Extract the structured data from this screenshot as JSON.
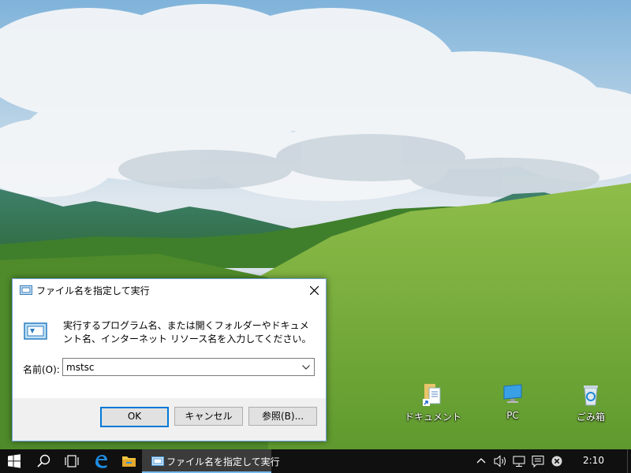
{
  "run_dialog": {
    "title": "ファイル名を指定して実行",
    "description": "実行するプログラム名、または開くフォルダーやドキュメント名、インターネット リソース名を入力してください。",
    "name_label": "名前(O):",
    "input_value": "mstsc",
    "ok_label": "OK",
    "cancel_label": "キャンセル",
    "browse_label": "参照(B)...",
    "icons": [
      "run-icon",
      "close-icon",
      "chevron-down-icon"
    ]
  },
  "desktop": {
    "icons": [
      {
        "label": "ドキュメント",
        "icon": "documents-shortcut-icon"
      },
      {
        "label": "PC",
        "icon": "pc-icon"
      },
      {
        "label": "ごみ箱",
        "icon": "recycle-bin-icon"
      }
    ]
  },
  "taskbar": {
    "pinned": [
      "start-icon",
      "search-icon",
      "task-view-icon",
      "edge-icon",
      "file-explorer-icon"
    ],
    "running_app_label": "ファイル名を指定して実行",
    "tray": [
      "chevron-up-icon",
      "volume-icon",
      "network-icon",
      "action-center-icon",
      "notification-off-icon"
    ],
    "clock": "2:10"
  },
  "colors": {
    "taskbar_bg": "#101010",
    "accent": "#0078d7",
    "dialog_bg": "#f0f0f0"
  }
}
